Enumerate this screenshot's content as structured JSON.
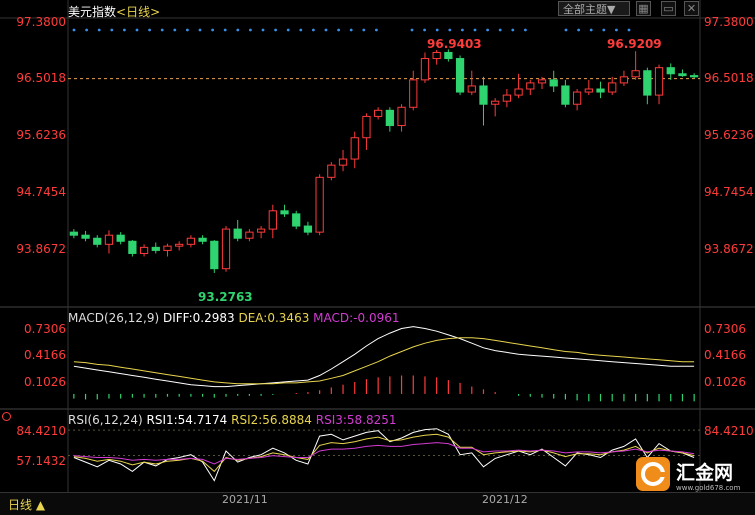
{
  "header": {
    "name": "美元指数",
    "period": "<日线>",
    "theme_button": "全部主题▼",
    "ctrl_icons": [
      "grid-icon",
      "minimize-icon",
      "close-icon"
    ]
  },
  "price_axis": [
    "97.3800",
    "96.5018",
    "95.6236",
    "94.7454",
    "93.8672"
  ],
  "price_markers": {
    "high1": "96.9403",
    "high2": "96.9209",
    "low": "93.2763"
  },
  "macd": {
    "label": "MACD(26,12,9)",
    "diff": "DIFF:0.2983",
    "dea": "DEA:0.3463",
    "macd": "MACD:-0.0961",
    "axis": [
      "0.7306",
      "0.4166",
      "0.1026"
    ]
  },
  "rsi": {
    "label": "RSI(6,12,24)",
    "rsi1": "RSI1:54.7174",
    "rsi2": "RSI2:56.8884",
    "rsi3": "RSI3:58.8251",
    "axis": [
      "84.4210",
      "57.1432"
    ]
  },
  "x_dates": [
    "2021/11",
    "2021/12"
  ],
  "footer": {
    "period": "日线 ▲"
  },
  "brand": {
    "name": "汇金网",
    "url": "www.gold678.com"
  },
  "colors": {
    "up": "#ff3b3b",
    "down": "#2fd36f",
    "diff": "#ffffff",
    "dea": "#e8d44d",
    "macd_label": "#d23bd2",
    "bg": "#000000",
    "dots": "#3a8fe8"
  },
  "chart_data": {
    "type": "candlestick",
    "ylim": [
      93.0,
      97.4
    ],
    "candles": [
      [
        93.95,
        94.0,
        93.85,
        93.9
      ],
      [
        93.9,
        93.97,
        93.8,
        93.85
      ],
      [
        93.85,
        93.9,
        93.7,
        93.75
      ],
      [
        93.75,
        93.98,
        93.6,
        93.9
      ],
      [
        93.9,
        93.95,
        93.75,
        93.8
      ],
      [
        93.8,
        93.82,
        93.55,
        93.6
      ],
      [
        93.6,
        93.75,
        93.55,
        93.7
      ],
      [
        93.7,
        93.78,
        93.6,
        93.65
      ],
      [
        93.65,
        93.76,
        93.55,
        93.72
      ],
      [
        93.72,
        93.8,
        93.65,
        93.75
      ],
      [
        93.75,
        93.9,
        93.7,
        93.85
      ],
      [
        93.85,
        93.9,
        93.75,
        93.8
      ],
      [
        93.8,
        93.82,
        93.28,
        93.35
      ],
      [
        93.35,
        94.05,
        93.3,
        94.0
      ],
      [
        94.0,
        94.15,
        93.8,
        93.85
      ],
      [
        93.85,
        94.0,
        93.8,
        93.95
      ],
      [
        93.95,
        94.05,
        93.85,
        94.0
      ],
      [
        94.0,
        94.4,
        93.85,
        94.3
      ],
      [
        94.3,
        94.4,
        94.2,
        94.25
      ],
      [
        94.25,
        94.3,
        94.0,
        94.05
      ],
      [
        94.05,
        94.12,
        93.9,
        93.95
      ],
      [
        93.95,
        94.9,
        93.9,
        94.85
      ],
      [
        94.85,
        95.1,
        94.8,
        95.05
      ],
      [
        95.05,
        95.3,
        94.95,
        95.15
      ],
      [
        95.15,
        95.6,
        95.0,
        95.5
      ],
      [
        95.5,
        95.9,
        95.3,
        95.85
      ],
      [
        95.85,
        96.0,
        95.8,
        95.95
      ],
      [
        95.95,
        96.0,
        95.6,
        95.7
      ],
      [
        95.7,
        96.05,
        95.6,
        96.0
      ],
      [
        96.0,
        96.6,
        95.95,
        96.45
      ],
      [
        96.45,
        96.9,
        96.4,
        96.8
      ],
      [
        96.8,
        96.94,
        96.7,
        96.9
      ],
      [
        96.9,
        96.95,
        96.75,
        96.8
      ],
      [
        96.8,
        96.85,
        96.2,
        96.25
      ],
      [
        96.25,
        96.6,
        96.2,
        96.35
      ],
      [
        96.35,
        96.5,
        95.7,
        96.05
      ],
      [
        96.05,
        96.15,
        95.85,
        96.1
      ],
      [
        96.1,
        96.3,
        96.0,
        96.2
      ],
      [
        96.2,
        96.55,
        96.15,
        96.3
      ],
      [
        96.3,
        96.45,
        96.2,
        96.4
      ],
      [
        96.4,
        96.5,
        96.3,
        96.45
      ],
      [
        96.45,
        96.6,
        96.25,
        96.35
      ],
      [
        96.35,
        96.45,
        96.0,
        96.05
      ],
      [
        96.05,
        96.3,
        95.95,
        96.25
      ],
      [
        96.25,
        96.45,
        96.2,
        96.3
      ],
      [
        96.3,
        96.42,
        96.15,
        96.25
      ],
      [
        96.25,
        96.5,
        96.2,
        96.4
      ],
      [
        96.4,
        96.6,
        96.35,
        96.5
      ],
      [
        96.5,
        96.92,
        96.45,
        96.6
      ],
      [
        96.6,
        96.65,
        96.05,
        96.2
      ],
      [
        96.2,
        96.7,
        96.05,
        96.65
      ],
      [
        96.65,
        96.72,
        96.45,
        96.55
      ],
      [
        96.55,
        96.62,
        96.5,
        96.52
      ],
      [
        96.52,
        96.56,
        96.48,
        96.5
      ]
    ],
    "macd_bars": [
      -0.05,
      -0.06,
      -0.06,
      -0.05,
      -0.05,
      -0.04,
      -0.04,
      -0.04,
      -0.03,
      -0.03,
      -0.03,
      -0.03,
      -0.04,
      -0.03,
      -0.02,
      -0.02,
      -0.02,
      -0.01,
      0.0,
      0.01,
      0.02,
      0.04,
      0.07,
      0.1,
      0.13,
      0.16,
      0.18,
      0.19,
      0.2,
      0.2,
      0.19,
      0.18,
      0.15,
      0.12,
      0.08,
      0.05,
      0.02,
      0.0,
      -0.02,
      -0.03,
      -0.04,
      -0.05,
      -0.06,
      -0.07,
      -0.08,
      -0.08,
      -0.08,
      -0.08,
      -0.08,
      -0.08,
      -0.08,
      -0.08,
      -0.08,
      -0.08
    ],
    "diff": [
      0.3,
      0.28,
      0.26,
      0.24,
      0.22,
      0.2,
      0.18,
      0.16,
      0.14,
      0.12,
      0.1,
      0.09,
      0.08,
      0.08,
      0.09,
      0.1,
      0.11,
      0.12,
      0.13,
      0.14,
      0.15,
      0.2,
      0.27,
      0.35,
      0.43,
      0.52,
      0.6,
      0.66,
      0.71,
      0.73,
      0.71,
      0.68,
      0.64,
      0.6,
      0.55,
      0.5,
      0.47,
      0.45,
      0.43,
      0.42,
      0.41,
      0.4,
      0.39,
      0.38,
      0.37,
      0.36,
      0.35,
      0.34,
      0.33,
      0.32,
      0.31,
      0.3,
      0.3,
      0.3
    ],
    "dea": [
      0.35,
      0.34,
      0.32,
      0.31,
      0.29,
      0.27,
      0.25,
      0.23,
      0.21,
      0.19,
      0.17,
      0.15,
      0.13,
      0.12,
      0.11,
      0.11,
      0.11,
      0.11,
      0.12,
      0.12,
      0.13,
      0.14,
      0.17,
      0.2,
      0.25,
      0.3,
      0.35,
      0.41,
      0.46,
      0.51,
      0.55,
      0.58,
      0.6,
      0.61,
      0.61,
      0.6,
      0.58,
      0.56,
      0.54,
      0.52,
      0.5,
      0.48,
      0.46,
      0.45,
      0.43,
      0.42,
      0.41,
      0.4,
      0.39,
      0.38,
      0.37,
      0.36,
      0.35,
      0.35
    ],
    "rsi1": [
      55,
      50,
      45,
      52,
      48,
      40,
      50,
      46,
      53,
      55,
      58,
      50,
      30,
      62,
      50,
      55,
      58,
      65,
      60,
      52,
      48,
      78,
      80,
      74,
      78,
      82,
      84,
      72,
      76,
      82,
      85,
      86,
      80,
      58,
      60,
      45,
      54,
      58,
      62,
      58,
      64,
      55,
      46,
      60,
      58,
      55,
      63,
      67,
      75,
      55,
      70,
      62,
      60,
      55
    ],
    "rsi2": [
      56,
      54,
      51,
      53,
      51,
      47,
      50,
      48,
      51,
      52,
      54,
      51,
      40,
      55,
      52,
      54,
      56,
      60,
      58,
      55,
      53,
      68,
      71,
      70,
      72,
      75,
      77,
      73,
      74,
      77,
      79,
      80,
      77,
      66,
      66,
      58,
      60,
      61,
      62,
      61,
      63,
      60,
      56,
      59,
      59,
      58,
      61,
      63,
      67,
      60,
      65,
      62,
      60,
      57
    ],
    "rsi3": [
      57,
      56,
      55,
      55,
      54,
      52,
      53,
      52,
      53,
      53,
      54,
      53,
      48,
      54,
      53,
      54,
      55,
      57,
      56,
      55,
      55,
      62,
      64,
      64,
      65,
      67,
      68,
      67,
      67,
      69,
      70,
      71,
      70,
      65,
      65,
      61,
      62,
      62,
      63,
      62,
      63,
      62,
      60,
      61,
      61,
      60,
      61,
      62,
      64,
      61,
      63,
      62,
      61,
      59
    ]
  }
}
